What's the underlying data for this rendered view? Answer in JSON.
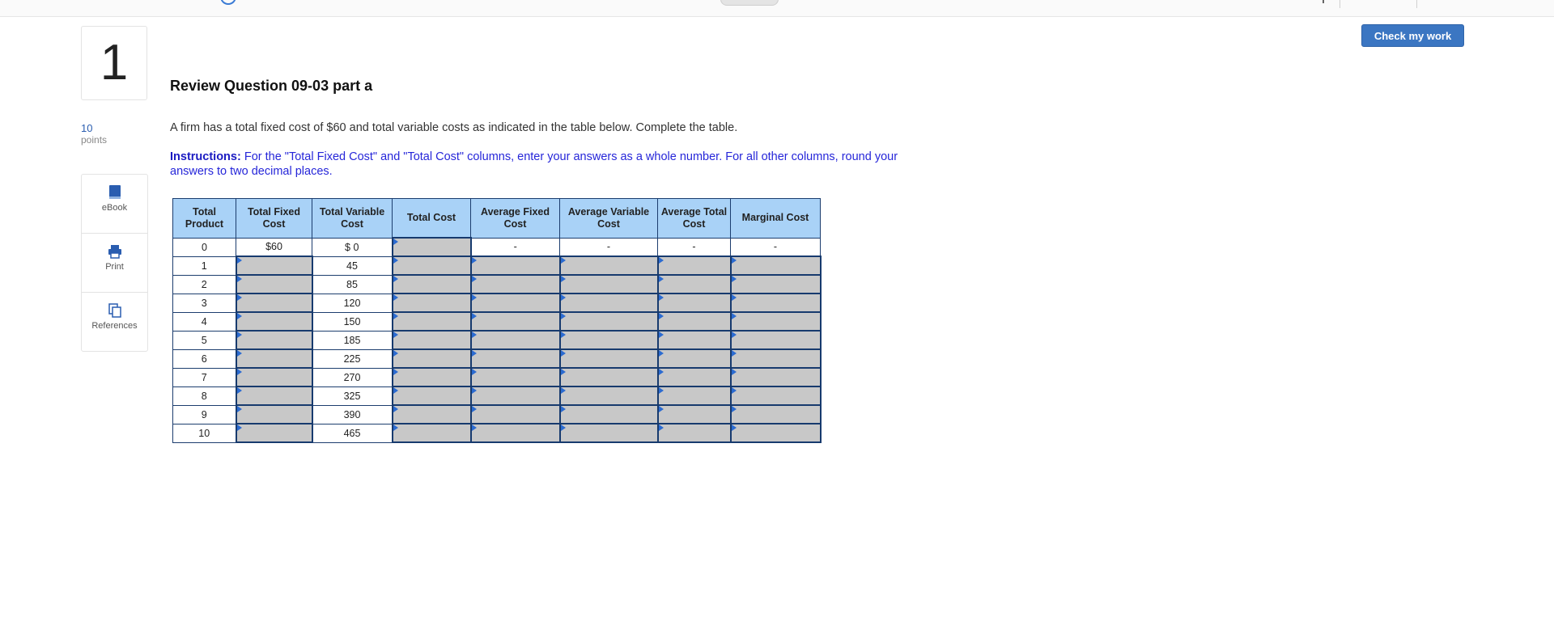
{
  "question": {
    "number": "1",
    "points_value": "10",
    "points_label": "points",
    "title": "Review Question 09-03 part a",
    "prompt": "A firm has a total fixed cost of $60 and total variable costs as indicated in the table below. Complete the table.",
    "instructions_label": "Instructions:",
    "instructions_text": " For the \"Total Fixed Cost\" and \"Total Cost\" columns, enter your answers as a whole number. For all other columns, round your answers to two decimal places."
  },
  "tools": {
    "ebook": "eBook",
    "print": "Print",
    "references": "References"
  },
  "check_button": "Check my work",
  "table": {
    "headers": [
      "Total Product",
      "Total Fixed Cost",
      "Total Variable Cost",
      "Total Cost",
      "Average Fixed Cost",
      "Average Variable Cost",
      "Average Total Cost",
      "Marginal Cost"
    ],
    "rows": [
      {
        "tp": "0",
        "tfc": "$60",
        "tvc": "$ 0",
        "afc": "-",
        "avc": "-",
        "atc": "-",
        "mc": "-"
      },
      {
        "tp": "1",
        "tvc": "45"
      },
      {
        "tp": "2",
        "tvc": "85"
      },
      {
        "tp": "3",
        "tvc": "120"
      },
      {
        "tp": "4",
        "tvc": "150"
      },
      {
        "tp": "5",
        "tvc": "185"
      },
      {
        "tp": "6",
        "tvc": "225"
      },
      {
        "tp": "7",
        "tvc": "270"
      },
      {
        "tp": "8",
        "tvc": "325"
      },
      {
        "tp": "9",
        "tvc": "390"
      },
      {
        "tp": "10",
        "tvc": "465"
      }
    ]
  },
  "colors": {
    "header_fill": "#a9d2f7",
    "input_fill": "#c8c8c8",
    "button": "#3b76c2",
    "instructions": "#2626d9"
  }
}
